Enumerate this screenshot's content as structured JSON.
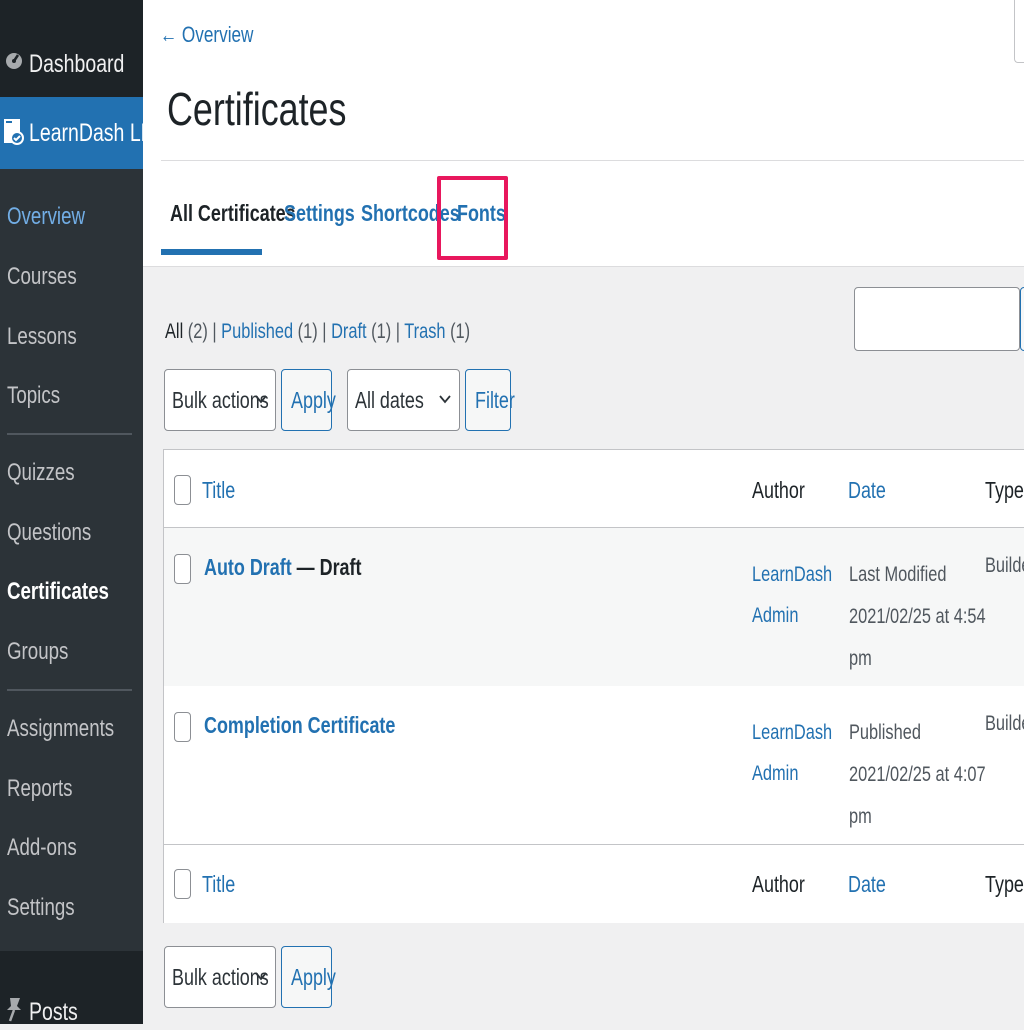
{
  "sidebar": {
    "dashboard": "Dashboard",
    "learndash": "LearnDash LMS",
    "items": [
      {
        "label": "Overview",
        "state": "current"
      },
      {
        "label": "Courses"
      },
      {
        "label": "Lessons"
      },
      {
        "label": "Topics"
      },
      {
        "label": "Quizzes"
      },
      {
        "label": "Questions"
      },
      {
        "label": "Certificates",
        "state": "active"
      },
      {
        "label": "Groups"
      },
      {
        "label": "Assignments"
      },
      {
        "label": "Reports"
      },
      {
        "label": "Add-ons"
      },
      {
        "label": "Settings"
      }
    ],
    "posts": "Posts"
  },
  "header": {
    "back_link": "← Overview",
    "title": "Certificates",
    "tabs": [
      {
        "label": "All Certificates",
        "active": true
      },
      {
        "label": "Settings"
      },
      {
        "label": "Shortcodes"
      },
      {
        "label": "Fonts",
        "highlighted": true
      }
    ]
  },
  "filters": {
    "all": "All",
    "all_count": "(2)",
    "published": "Published",
    "published_count": "(1)",
    "draft": "Draft",
    "draft_count": "(1)",
    "trash": "Trash",
    "trash_count": "(1)",
    "separator": "|",
    "bulk_actions": "Bulk actions",
    "apply": "Apply",
    "all_dates": "All dates",
    "filter": "Filter"
  },
  "table": {
    "columns": {
      "title": "Title",
      "author": "Author",
      "date": "Date",
      "type": "Type"
    },
    "rows": [
      {
        "title": "Auto Draft",
        "state": " — Draft",
        "author_line1": "LearnDash",
        "author_line2": "Admin",
        "date_status": "Last Modified",
        "date_line": "2021/02/25 at 4:54",
        "date_tail": "pm",
        "type": "Builder"
      },
      {
        "title": "Completion Certificate",
        "state": "",
        "author_line1": "LearnDash",
        "author_line2": "Admin",
        "date_status": "Published",
        "date_line": "2021/02/25 at 4:07",
        "date_tail": "pm",
        "type": "Builder"
      }
    ]
  },
  "bottom": {
    "bulk_actions": "Bulk actions",
    "apply": "Apply"
  },
  "colors": {
    "accent": "#2271b1",
    "sidebar": "#2c3338",
    "highlight": "#e8175d"
  }
}
